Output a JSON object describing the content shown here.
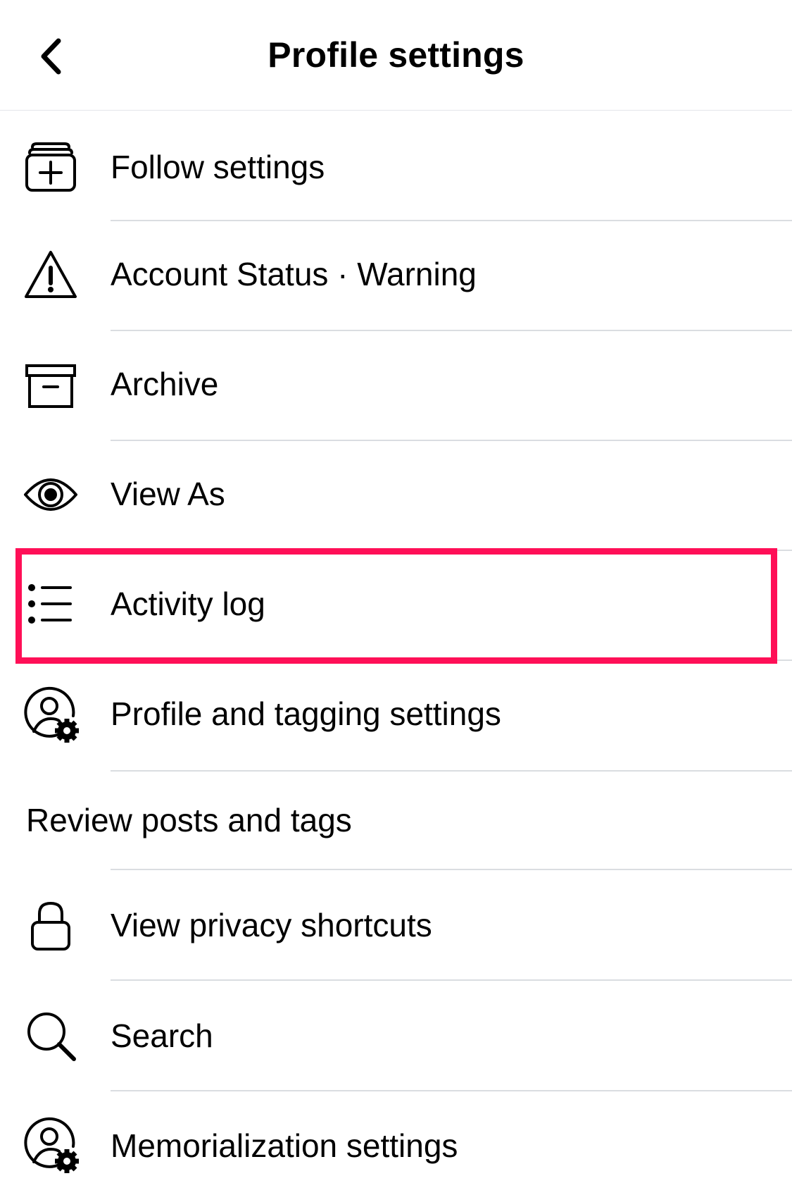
{
  "header": {
    "title": "Profile settings",
    "back_icon": "chevron-left-icon"
  },
  "menu": {
    "items": [
      {
        "label": "Follow settings",
        "icon": "follow-add-icon"
      },
      {
        "label": "Account Status · Warning",
        "icon": "warning-icon"
      },
      {
        "label": "Archive",
        "icon": "archive-box-icon"
      },
      {
        "label": "View As",
        "icon": "eye-icon"
      },
      {
        "label": "Activity log",
        "icon": "list-icon"
      },
      {
        "label": "Profile and tagging settings",
        "icon": "profile-gear-icon"
      }
    ],
    "section_title": "Review posts and tags",
    "items2": [
      {
        "label": "View privacy shortcuts",
        "icon": "lock-icon"
      },
      {
        "label": "Search",
        "icon": "search-icon"
      },
      {
        "label": "Memorialization settings",
        "icon": "profile-gear-icon"
      }
    ]
  },
  "colors": {
    "highlight": "#ff0f57",
    "separator": "#dadde1",
    "text": "#000000"
  }
}
